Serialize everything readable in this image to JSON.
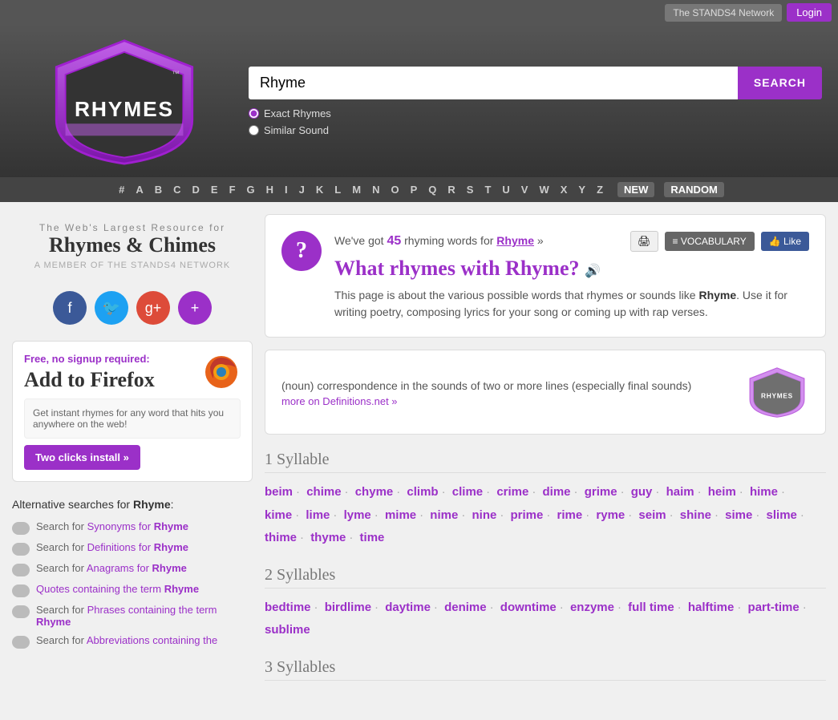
{
  "topBar": {
    "network": "The STANDS4 Network",
    "login": "Login"
  },
  "header": {
    "searchValue": "Rhyme",
    "searchPlaceholder": "Rhyme",
    "searchBtn": "SEARCH",
    "radio": {
      "exactLabel": "Exact Rhymes",
      "similarLabel": "Similar Sound"
    }
  },
  "nav": {
    "letters": [
      "#",
      "A",
      "B",
      "C",
      "D",
      "E",
      "F",
      "G",
      "H",
      "I",
      "J",
      "K",
      "L",
      "M",
      "N",
      "O",
      "P",
      "Q",
      "R",
      "S",
      "T",
      "U",
      "V",
      "W",
      "X",
      "Y",
      "Z"
    ],
    "new": "NEW",
    "random": "RANDOM"
  },
  "sidebar": {
    "subTitle": "The Web's Largest Resource for",
    "mainTitle": "Rhymes & Chimes",
    "memberLine": "A MEMBER OF THE STANDS4 NETWORK",
    "firefoxBox": {
      "freeText": "Free, no signup required:",
      "heading": "Add to Firefox",
      "innerText": "Get instant rhymes for any word that hits you anywhere on the web!",
      "installBtn": "Two clicks install »"
    },
    "altTitle": "Alternative searches for",
    "altWord": "Rhyme",
    "altItems": [
      {
        "label": "Search for ",
        "link": "Synonyms for ",
        "linkWord": "Rhyme"
      },
      {
        "label": "Search for ",
        "link": "Definitions for ",
        "linkWord": "Rhyme"
      },
      {
        "label": "Search for ",
        "link": "Anagrams for ",
        "linkWord": "Rhyme"
      },
      {
        "label": "",
        "link": "Quotes containing the term ",
        "linkWord": "Rhyme"
      },
      {
        "label": "Search for ",
        "link": "Phrases containing the term ",
        "linkWord": "Rhyme"
      },
      {
        "label": "Search for ",
        "link": "Abbreviations containing the",
        "linkWord": ""
      }
    ]
  },
  "infoBox": {
    "count": "45",
    "countLabel": "rhyming words for",
    "word": "Rhyme",
    "question": "What rhymes with Rhyme?",
    "desc": "This page is about the various possible words that rhymes or sounds like",
    "wordBold": "Rhyme",
    "desc2": ". Use it for writing poetry, composing lyrics for your song or coming up with rap verses.",
    "printBtn": "🖨",
    "vocabBtn": "≡ VOCABULARY",
    "likeBtn": "👍 Like"
  },
  "defBox": {
    "text": "(noun) correspondence in the sounds of two or more lines (especially final sounds)",
    "moreLink": "more on Definitions.net »",
    "logoAlt": "Rhymes logo"
  },
  "rhymeSections": [
    {
      "heading": "1 Syllable",
      "words": [
        "beim",
        "chime",
        "chyme",
        "climb",
        "clime",
        "crime",
        "dime",
        "grime",
        "guy",
        "haim",
        "heim",
        "hime",
        "kime",
        "lime",
        "lyme",
        "mime",
        "nime",
        "nine",
        "prime",
        "rime",
        "ryme",
        "seim",
        "shine",
        "sime",
        "slime",
        "thime",
        "thyme",
        "time"
      ]
    },
    {
      "heading": "2 Syllables",
      "words": [
        "bedtime",
        "birdlime",
        "daytime",
        "denime",
        "downtime",
        "enzyme",
        "full time",
        "halftime",
        "part-time",
        "sublime"
      ]
    },
    {
      "heading": "3 Syllables",
      "words": []
    }
  ]
}
